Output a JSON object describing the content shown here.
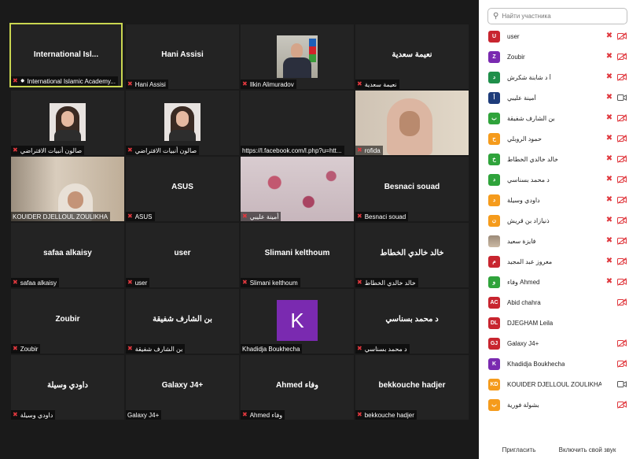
{
  "gallery": {
    "tiles": [
      {
        "big": "International  Isl...",
        "caption": "International Islamic Academy...",
        "pinned": true,
        "active": true
      },
      {
        "big": "Hani Assisi",
        "caption": "Hani Assisi"
      },
      {
        "big": "",
        "caption": "Ilkin Alimuradov",
        "photo": "man"
      },
      {
        "big": "نعيمة سعدية",
        "caption": "نعيمة سعدية"
      },
      {
        "big": "",
        "caption": "صالون أنبيات الافتراضي",
        "photo": "woman"
      },
      {
        "big": "",
        "caption": "صالون أنبيات الافتراضي",
        "photo": "woman"
      },
      {
        "big": "",
        "caption": "https://l.facebook.com/l.php?u=htt...",
        "nomic": true
      },
      {
        "big": "",
        "caption": "rofida",
        "photo": "video-hijab"
      },
      {
        "big": "",
        "caption": "KOUIDER DJELLOUL ZOULIKHA",
        "photo": "video-hijab2",
        "nomic": true
      },
      {
        "big": "ASUS",
        "caption": "ASUS"
      },
      {
        "big": "",
        "caption": "أمينة عليبي",
        "photo": "video-floral"
      },
      {
        "big": "Besnaci souad",
        "caption": "Besnaci souad"
      },
      {
        "big": "safaa alkaisy",
        "caption": "safaa alkaisy"
      },
      {
        "big": "user",
        "caption": "user"
      },
      {
        "big": "Slimani kelthoum",
        "caption": "Slimani kelthoum"
      },
      {
        "big": "خالد خالدي الخطاط",
        "caption": "خالد خالدي الخطاط"
      },
      {
        "big": "Zoubir",
        "caption": "Zoubir"
      },
      {
        "big": "بن الشارف شفيقة",
        "caption": "بن الشارف شفيقة"
      },
      {
        "big": "",
        "caption": "Khadidja Boukhecha",
        "photo": "k-avatar",
        "nomic": true
      },
      {
        "big": "د محمد بسناسي",
        "caption": "د محمد بسناسي"
      },
      {
        "big": "داودي وسيلة",
        "caption": "داودي وسيلة"
      },
      {
        "big": "Galaxy J4+",
        "caption": "Galaxy J4+",
        "nomic": true
      },
      {
        "big": "Ahmed وفاء",
        "caption": "Ahmed وفاء"
      },
      {
        "big": "bekkouche hadjer",
        "caption": "bekkouche hadjer"
      }
    ],
    "k_letter": "K"
  },
  "panel": {
    "search_placeholder": "Найти участника",
    "participants": [
      {
        "initials": "U",
        "name": "user",
        "color": "#c8252f",
        "mic": true,
        "cam": "off"
      },
      {
        "initials": "Z",
        "name": "Zoubir",
        "color": "#7a2ab0",
        "mic": true,
        "cam": "off"
      },
      {
        "initials": "د",
        "name": "أ د شابنة شكرش",
        "color": "#1f8f4a",
        "mic": true,
        "cam": "off"
      },
      {
        "initials": "أ",
        "name": "أمينة عليبي",
        "color": "#1e3c7a",
        "mic": true,
        "cam": "on"
      },
      {
        "initials": "ب",
        "name": "بن الشارف شفيقة",
        "color": "#2fa33b",
        "mic": true,
        "cam": "off"
      },
      {
        "initials": "ح",
        "name": "حمود الروبلي",
        "color": "#f59b1c",
        "mic": true,
        "cam": "off"
      },
      {
        "initials": "خ",
        "name": "خالد خالدي الخطاط",
        "color": "#2fa33b",
        "mic": true,
        "cam": "off"
      },
      {
        "initials": "د",
        "name": "د محمد بسناسي",
        "color": "#2fa33b",
        "mic": true,
        "cam": "off"
      },
      {
        "initials": "د",
        "name": "داودي وسيلة",
        "color": "#f59b1c",
        "mic": true,
        "cam": "off"
      },
      {
        "initials": "ن",
        "name": "ذنيازاد بن قريش",
        "color": "#f59b1c",
        "mic": true,
        "cam": "off"
      },
      {
        "initials": "",
        "name": "فايزة سعيد",
        "color": "#b9a58e",
        "mic": true,
        "cam": "off",
        "photo": true
      },
      {
        "initials": "م",
        "name": "معروز عبد المجيد",
        "color": "#c8252f",
        "mic": true,
        "cam": "off"
      },
      {
        "initials": "و",
        "name": "وفاء Ahmed",
        "color": "#2fa33b",
        "mic": true,
        "cam": "off"
      },
      {
        "initials": "AC",
        "name": "Abid chahra",
        "color": "#c8252f",
        "mic": false,
        "cam": "off"
      },
      {
        "initials": "DL",
        "name": "DJEGHAM Leila",
        "color": "#c8252f",
        "mic": false,
        "cam": "none"
      },
      {
        "initials": "GJ",
        "name": "Galaxy J4+",
        "color": "#c8252f",
        "mic": false,
        "cam": "off"
      },
      {
        "initials": "K",
        "name": "Khadidja Boukhecha",
        "color": "#7a2ab0",
        "mic": false,
        "cam": "off"
      },
      {
        "initials": "KD",
        "name": "KOUIDER DJELLOUL ZOULIKHA",
        "color": "#f59b1c",
        "mic": false,
        "cam": "on"
      },
      {
        "initials": "ب",
        "name": "بشولة فورية",
        "color": "#f59b1c",
        "mic": false,
        "cam": "off"
      }
    ],
    "invite_label": "Пригласить",
    "unmute_label": "Включить свой звук"
  },
  "colors": {
    "active_border": "#c9d650",
    "mic_muted": "#e0383e",
    "tile_bg": "#232323"
  },
  "icons": {
    "mic": "mic-muted-icon",
    "cam": "camera-off-icon",
    "search": "search-icon",
    "pin": "pin-icon"
  }
}
